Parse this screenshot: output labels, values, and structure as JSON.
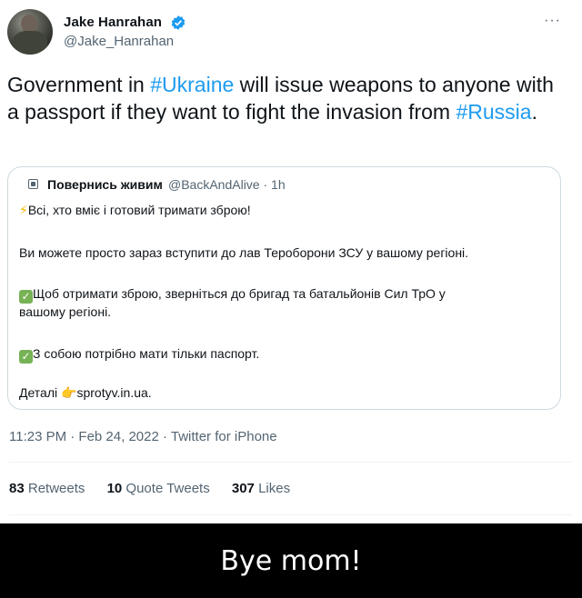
{
  "tweet": {
    "author_name": "Jake Hanrahan",
    "handle": "@Jake_Hanrahan",
    "more_label": "···",
    "text_part1": "Government in ",
    "hashtag1": "#Ukraine",
    "text_part2": " will issue weapons to anyone with a passport if they want to fight the invasion from ",
    "hashtag2": "#Russia",
    "text_part3": ".",
    "quote": {
      "author_name": "Повернись живим",
      "meta": "@BackAndAlive · 1h",
      "line1": "Всі, хто вміє і готовий тримати зброю!",
      "line2": "Ви можете просто зараз вступити до лав Тероборони ЗСУ у вашому регіоні.",
      "line3": "Щоб отримати зброю, зверніться до бригад та батальйонів Сил ТрО у",
      "line3b": "вашому регіоні.",
      "line4": "З собою потрібно мати тільки паспорт.",
      "line5_prefix": "Деталі ",
      "line5_link": "sprotyv.in.ua."
    },
    "timestamp": "11:23 PM · Feb 24, 2022 · Twitter for iPhone",
    "stats": {
      "retweets_count": "83",
      "retweets_label": "Retweets",
      "quotes_count": "10",
      "quotes_label": "Quote Tweets",
      "likes_count": "307",
      "likes_label": "Likes"
    }
  },
  "caption": "Bye mom!",
  "colors": {
    "link": "#1d9bf0",
    "verified": "#1d9bf0",
    "check_emoji": "#77b255"
  },
  "icons": [
    "verified-badge-icon",
    "more-icon",
    "quote-avatar-icon",
    "lightning-emoji-icon",
    "check-emoji-icon",
    "pointing-hand-emoji-icon"
  ]
}
